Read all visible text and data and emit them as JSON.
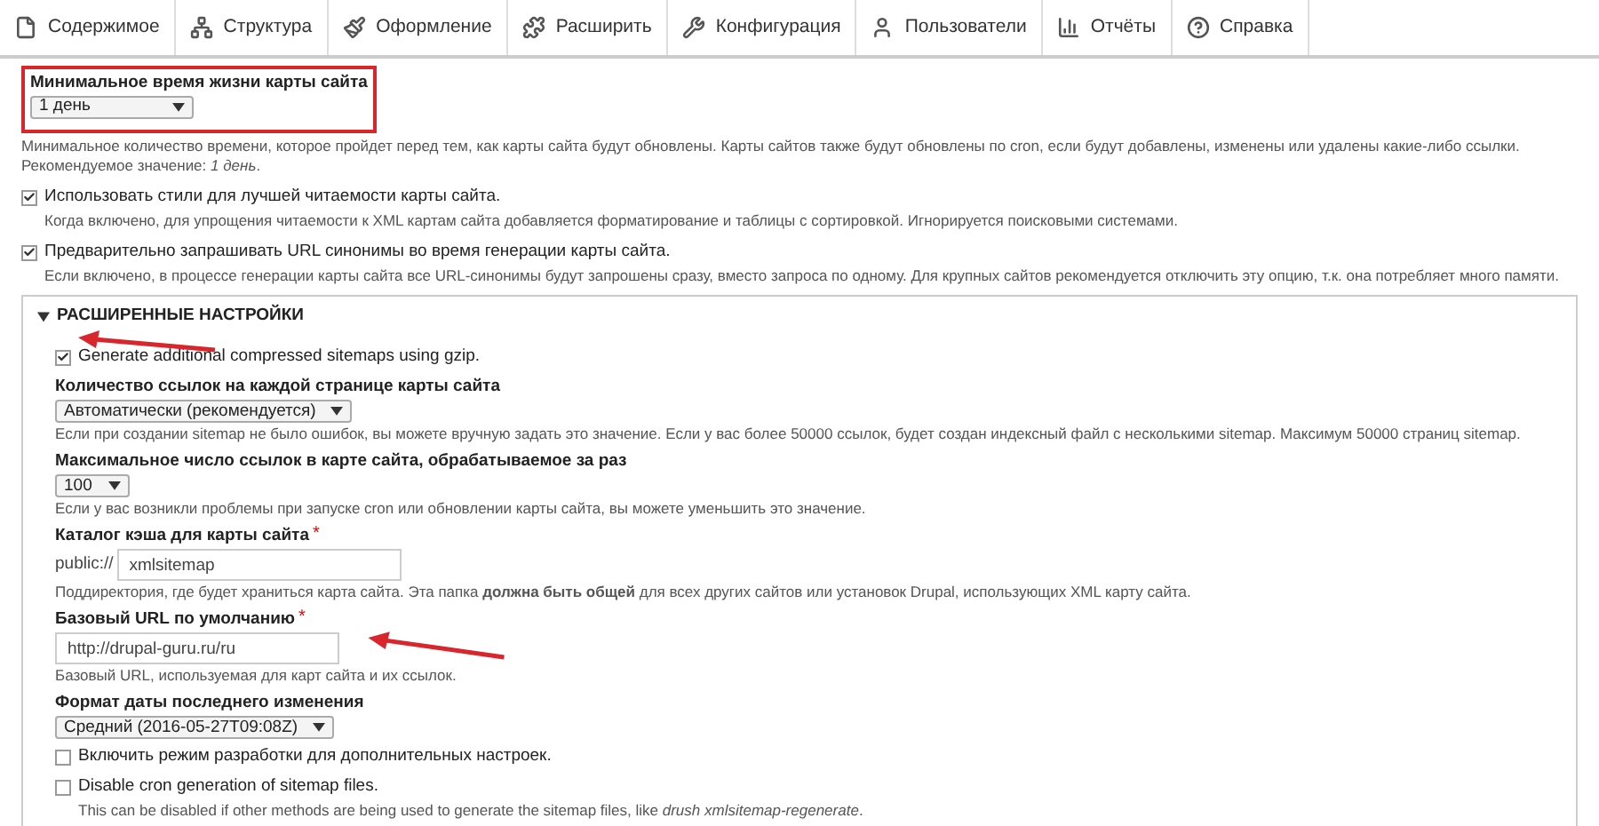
{
  "toolbar": [
    {
      "label": "Содержимое"
    },
    {
      "label": "Структура"
    },
    {
      "label": "Оформление"
    },
    {
      "label": "Расширить"
    },
    {
      "label": "Конфигурация"
    },
    {
      "label": "Пользователи"
    },
    {
      "label": "Отчёты"
    },
    {
      "label": "Справка"
    }
  ],
  "items": [
    {
      "kind": "select",
      "label": "Минимальное время жизни карты сайта",
      "value": "1 день",
      "highlighted": true,
      "description": [
        "Минимальное количество времени, которое пройдет перед тем, как карты сайта будут обновлены. Карты сайтов также будут обновлены по cron, если будут добавлены, изменены или удалены какие-либо ссылки.",
        "Рекомендуемое значение: *1 день*."
      ]
    },
    {
      "kind": "checkbox",
      "label": "Использовать стили для лучшей читаемости карты сайта.",
      "checked": true,
      "description": [
        "Когда включено, для упрощения читаемости к XML картам сайта добавляется форматирование и таблицы с сортировкой. Игнорируется поисковыми системами."
      ]
    },
    {
      "kind": "checkbox",
      "label": "Предварительно запрашивать URL синонимы во время генерации карты сайта.",
      "checked": true,
      "description": [
        "Если включено, в процессе генерации карты сайта все URL-синонимы будут запрошены сразу, вместо запроса по одному. Для крупных сайтов рекомендуется отключить эту опцию, т.к. она потребляет много памяти."
      ]
    }
  ],
  "advanced": {
    "title": "РАСШИРЕННЫЕ НАСТРОЙКИ",
    "expanded": true,
    "items": [
      {
        "kind": "checkbox",
        "label": "Generate additional compressed sitemaps using gzip.",
        "checked": true,
        "arrow": true
      },
      {
        "kind": "select",
        "label": "Количество ссылок на каждой странице карты сайта",
        "value": "Автоматически (рекомендуется)",
        "description": [
          "Если при создании sitemap не было ошибок, вы можете вручную задать это значение. Если у вас более 50000 ссылок, будет создан индексный файл с несколькими sitemap. Максимум 50000 страниц sitemap."
        ]
      },
      {
        "kind": "select",
        "label": "Максимальное число ссылок в карте сайта, обрабатываемое за раз",
        "value": "100",
        "description": [
          "Если у вас возникли проблемы при запуске cron или обновлении карты сайта, вы можете уменьшить это значение."
        ]
      },
      {
        "kind": "textfield",
        "label": "Каталог кэша для карты сайта",
        "required_mark": "*",
        "prefix": "public://",
        "value": "xmlsitemap",
        "description": [
          "Поддиректория, где будет храниться карта сайта. Эта папка **должна быть общей** для всех других сайтов или установок Drupal, использующих XML карту сайта."
        ]
      },
      {
        "kind": "textfield",
        "label": "Базовый URL по умолчанию",
        "required_mark": "*",
        "value": "http://drupal-guru.ru/ru",
        "arrow": true,
        "description": [
          "Базовый URL, используемая для карт сайта и их ссылок."
        ]
      },
      {
        "kind": "select",
        "label": "Формат даты последнего изменения",
        "value": "Средний (2016-05-27T09:08Z)"
      },
      {
        "kind": "checkbox",
        "label": "Включить режим разработки для дополнительных настроек.",
        "checked": false
      },
      {
        "kind": "checkbox",
        "label": "Disable cron generation of sitemap files.",
        "checked": false,
        "description": [
          "This can be disabled if other methods are being used to generate the sitemap files, like *drush xmlsitemap-regenerate*."
        ]
      }
    ]
  }
}
